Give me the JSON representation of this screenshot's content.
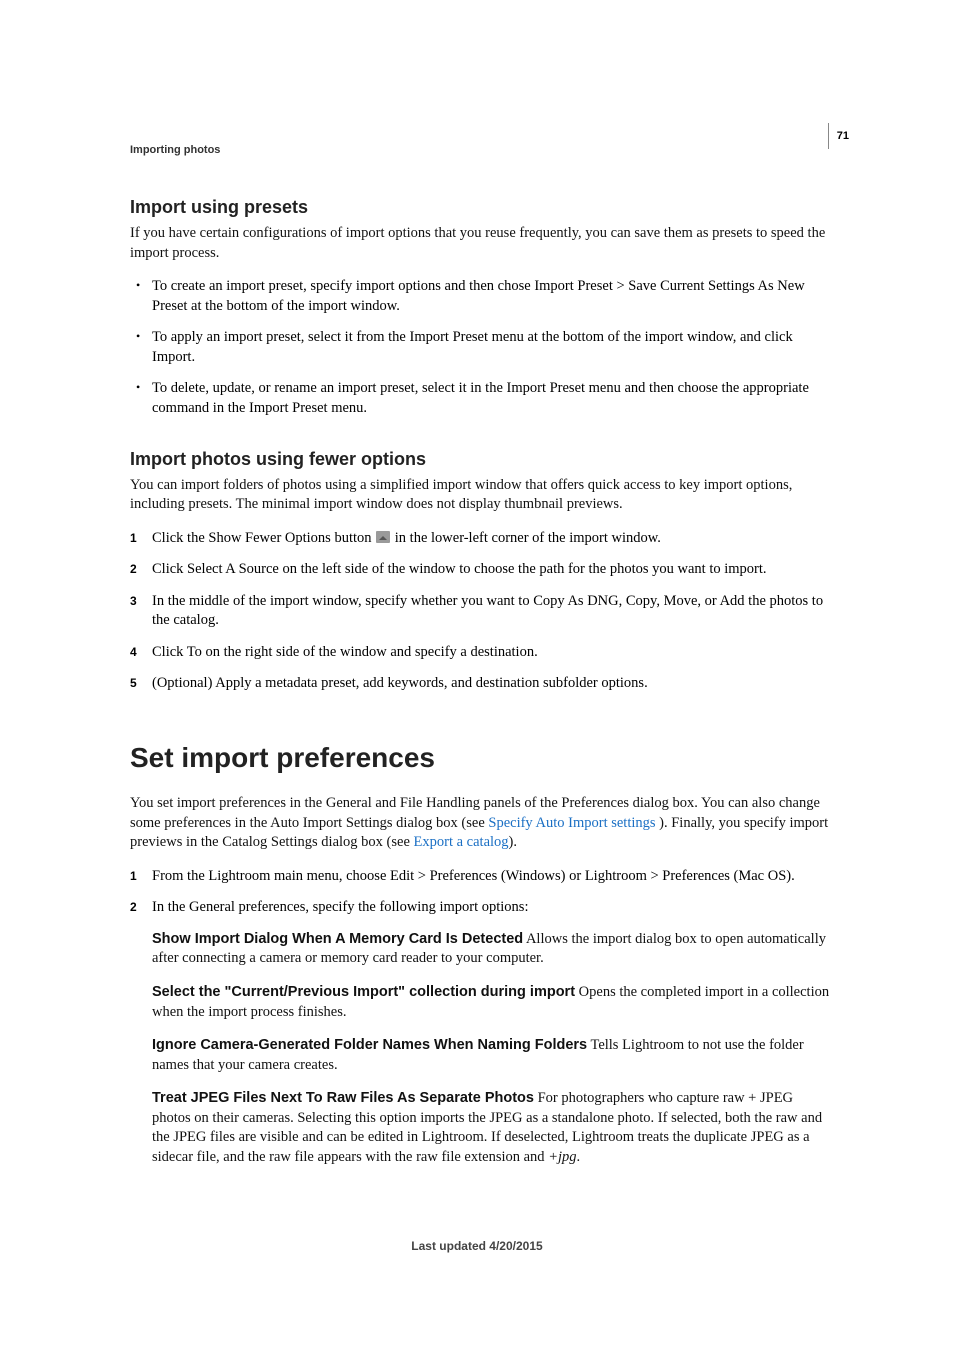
{
  "page_number": "71",
  "header": "Importing photos",
  "sections": {
    "presets": {
      "title": "Import using presets",
      "intro": "If you have certain configurations of import options that you reuse frequently, you can save them as presets to speed the import process.",
      "bullets": [
        "To create an import preset, specify import options and then chose Import Preset > Save Current Settings As New Preset at the bottom of the import window.",
        "To apply an import preset, select it from the Import Preset menu at the bottom of the import window, and click Import.",
        "To delete, update, or rename an import preset, select it in the Import Preset menu and then choose the appropriate command in the Import Preset menu."
      ]
    },
    "fewer": {
      "title": "Import photos using fewer options",
      "intro": "You can import folders of photos using a simplified import window that offers quick access to key import options, including presets. The minimal import window does not display thumbnail previews.",
      "steps": {
        "s1a": "Click the Show Fewer Options button ",
        "s1b": " in the lower-left corner of the import window.",
        "s2": "Click Select A Source on the left side of the window to choose the path for the photos you want to import.",
        "s3": "In the middle of the import window, specify whether you want to Copy As DNG, Copy, Move, or Add the photos to the catalog.",
        "s4": "Click To on the right side of the window and specify a destination.",
        "s5": "(Optional) Apply a metadata preset, add keywords, and destination subfolder options."
      }
    },
    "prefs": {
      "title": "Set import preferences",
      "intro_a": "You set import preferences in the General and File Handling panels of the Preferences dialog box. You can also change some preferences in the Auto Import Settings dialog box (see ",
      "link1": "Specify Auto Import settings ",
      "intro_b": "). Finally, you specify import previews in the Catalog Settings dialog box (see ",
      "link2": "Export a catalog",
      "intro_c": ").",
      "step1": "From the Lightroom main menu, choose Edit > Preferences (Windows) or Lightroom > Preferences (Mac OS).",
      "step2": "In the General preferences, specify the following import options:",
      "defs": {
        "d1t": "Show Import Dialog When A Memory Card Is Detected",
        "d1b": "  Allows the import dialog box to open automatically after connecting a camera or memory card reader to your computer.",
        "d2t": "Select the \"Current/Previous Import\" collection during import",
        "d2b": "  Opens the completed import in a collection when the import process finishes.",
        "d3t": "Ignore Camera-Generated Folder Names When Naming Folders",
        "d3b": "  Tells Lightroom to not use the folder names that your camera creates.",
        "d4t": "Treat JPEG Files Next To Raw Files As Separate Photos",
        "d4b_a": "  For photographers who capture raw + JPEG photos on their cameras. Selecting this option imports the JPEG as a standalone photo. If selected, both the raw and the JPEG files are visible and can be edited in Lightroom. If deselected, Lightroom treats the duplicate JPEG as a sidecar file, and the raw file appears with the raw file extension and ",
        "d4b_b": "+jpg",
        "d4b_c": "."
      }
    }
  },
  "footer": "Last updated 4/20/2015"
}
